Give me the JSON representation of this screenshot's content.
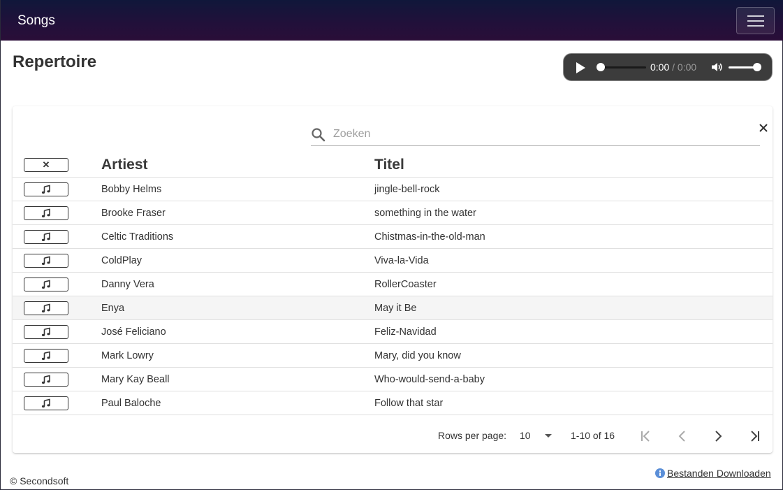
{
  "app": {
    "brand": "Songs"
  },
  "page": {
    "title": "Repertoire"
  },
  "player": {
    "current_time": "0:00",
    "duration": "/ 0:00"
  },
  "search": {
    "placeholder": "Zoeken",
    "value": ""
  },
  "table": {
    "headers": {
      "artist": "Artiest",
      "title": "Titel"
    },
    "rows": [
      {
        "artist": "Bobby Helms",
        "title": "jingle-bell-rock"
      },
      {
        "artist": "Brooke Fraser",
        "title": "something in the water"
      },
      {
        "artist": "Celtic Traditions",
        "title": "Chistmas-in-the-old-man"
      },
      {
        "artist": "ColdPlay",
        "title": "Viva-la-Vida"
      },
      {
        "artist": "Danny Vera",
        "title": "RollerCoaster"
      },
      {
        "artist": "Enya",
        "title": "May it Be"
      },
      {
        "artist": "José Feliciano",
        "title": "Feliz-Navidad"
      },
      {
        "artist": "Mark Lowry",
        "title": "Mary, did you know"
      },
      {
        "artist": "Mary Kay Beall",
        "title": "Who-would-send-a-baby"
      },
      {
        "artist": "Paul Baloche",
        "title": "Follow that star"
      }
    ],
    "highlighted_row": 5
  },
  "pagination": {
    "rows_per_page_label": "Rows per page:",
    "rows_per_page": "10",
    "range": "1-10 of 16"
  },
  "footer": {
    "copyright": "© Secondsoft",
    "download_label": "Bestanden Downloaden"
  },
  "icons": {
    "row_button": "music-note-icon",
    "header_button": "close-icon",
    "search": "search-icon",
    "clear": "close-icon",
    "info": "info-icon"
  },
  "colors": {
    "navbar": "#22103a",
    "info": "#5b8fd8"
  }
}
